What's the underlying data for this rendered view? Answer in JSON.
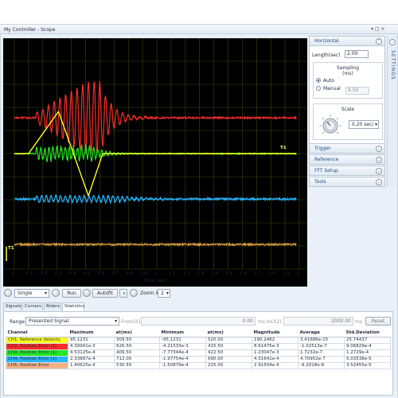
{
  "window": {
    "title": "My Controller - Scope",
    "controls": "▾ □ ×"
  },
  "scope": {
    "x_ticks": [
      "0",
      "0.1",
      "0.2",
      "0.3",
      "0.4",
      "0.5",
      "0.6",
      "0.7",
      "0.8",
      "0.9",
      "1",
      "1.1",
      "1.2",
      "1.3",
      "1.4",
      "1.5",
      "1.6",
      "1.7",
      "1.8",
      "1.9",
      "2"
    ],
    "xlabel": "Time (sec)",
    "trigger_label": "T1",
    "trigger_label2": "T1",
    "colors": {
      "red": "#ff2a2a",
      "green": "#22e622",
      "yellow": "#ffff1a",
      "blue": "#27b5ff",
      "orange": "#e0a040",
      "grid": "#3a4a10"
    }
  },
  "controls": {
    "mode": "Single",
    "run": "Run",
    "autofit": "Autofit",
    "v": "v",
    "zoom_label": "Zoom X",
    "zoom_value": "2"
  },
  "settings": {
    "tab_label": "SETTINGS",
    "horizontal": {
      "title": "Horizontal",
      "length_label": "Length(sec)",
      "length_value": "2.00",
      "sampling_title": "Sampling",
      "sampling_unit": "(ms)",
      "auto": "Auto",
      "manual": "Manual",
      "manual_value": "0.50",
      "scale_title": "Scale",
      "scale_value": "0.20 sec/"
    },
    "sections": [
      "Trigger",
      "Reference",
      "FFT Setup",
      "Tools"
    ]
  },
  "bottom": {
    "tabs": [
      "Signals",
      "Cursors",
      "Riders",
      "Statistics"
    ],
    "range_label": "Range",
    "range_value": "Presented Signal",
    "from_label": "From(X1)",
    "from_value": "0.00",
    "to_label": "ms  to(X2)",
    "to_value": "2000.00",
    "ms": "ms",
    "reset": "Reset",
    "columns": [
      "Channel",
      "Maximum",
      "at(ms)",
      "Minimum",
      "at(ms)",
      "Magnitude",
      "Average",
      "Std.Deviation"
    ],
    "rows": [
      {
        "channel": "CH1: Reference Velocity",
        "color": "#ffff1a",
        "max": "95.1231",
        "at1": "309.50",
        "min": "-95.1231",
        "at2": "520.00",
        "mag": "190.2462",
        "avg": "3.41686e-15",
        "std": "25.74437"
      },
      {
        "channel": "CH2: Position Error (1)",
        "color": "#ff2a2a",
        "max": "4.39941e-3",
        "at1": "626.50",
        "min": "-4.21533e-3",
        "at2": "415.50",
        "mag": "8.61475e-3",
        "avg": "-1.02513e-7",
        "std": "9.06829e-4"
      },
      {
        "channel": "CH3: Position Error (1)",
        "color": "#22e622",
        "max": "4.53125e-4",
        "at1": "409.50",
        "min": "-7.77344e-4",
        "at2": "422.50",
        "mag": "1.23047e-3",
        "avg": "1.7232e-7",
        "std": "1.2729e-4"
      },
      {
        "channel": "CH4: Position Error (1)",
        "color": "#27b5ff",
        "max": "2.33887e-4",
        "at1": "712.00",
        "min": "-1.97754e-4",
        "at2": "690.00",
        "mag": "4.31641e-4",
        "avg": "4.70952e-7",
        "std": "5.03538e-5"
      },
      {
        "channel": "CH5: Position Error",
        "color": "#f4b183",
        "max": "1.40625e-4",
        "at1": "530.50",
        "min": "-1.50879e-4",
        "at2": "225.00",
        "mag": "2.91504e-4",
        "avg": "-9.2018e-8",
        "std": "3.52455e-5"
      }
    ]
  }
}
